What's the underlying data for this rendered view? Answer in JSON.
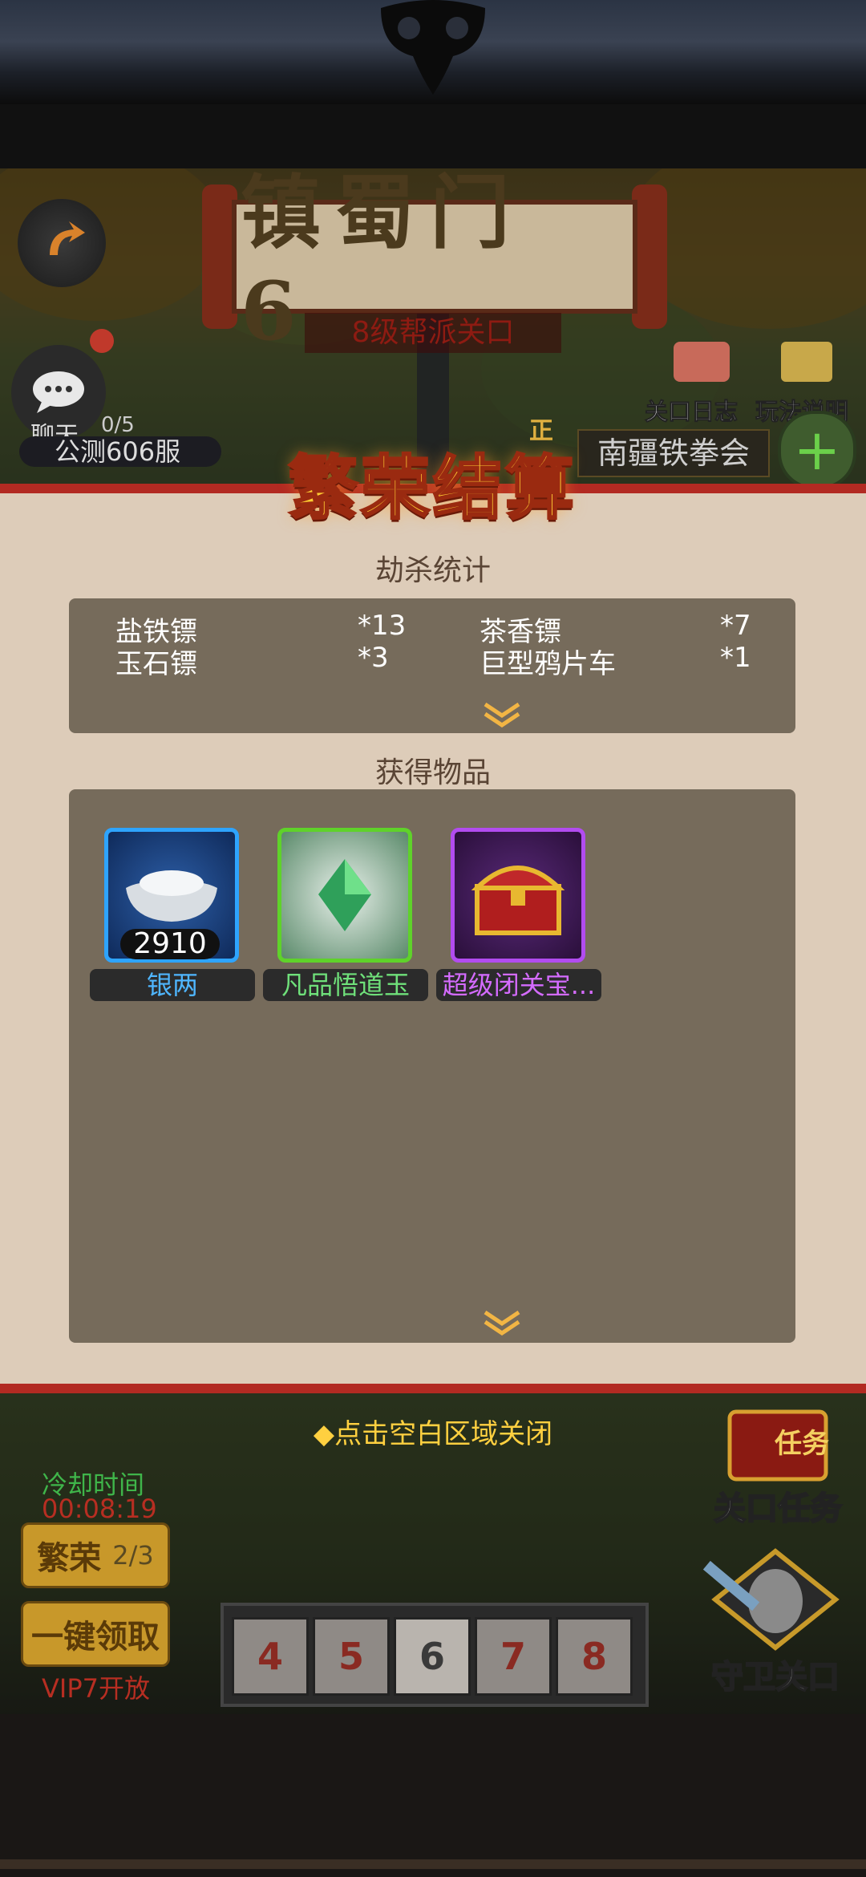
{
  "scene": {
    "stage_title": "镇蜀门 6",
    "stage_subtitle": "8级帮派关口",
    "chat_label": "聊天",
    "chat_count": "0/5",
    "server_name": "公测606服",
    "gate_log_label": "关口日志",
    "how_to_play_label": "玩法说明",
    "guild_name": "南疆铁拳会",
    "badge_zheng": "正"
  },
  "panel": {
    "title": "繁荣结算",
    "kill_stats_title": "劫杀统计",
    "kill_stats": [
      {
        "name": "盐铁镖",
        "count": "*13"
      },
      {
        "name": "茶香镖",
        "count": "*7"
      },
      {
        "name": "玉石镖",
        "count": "*3"
      },
      {
        "name": "巨型鸦片车",
        "count": "*1"
      }
    ],
    "items_title": "获得物品",
    "items": [
      {
        "name": "银两",
        "count": "2910",
        "rarity": "blue",
        "icon": "silver-ingot-icon",
        "name_color": "#4fb6ff"
      },
      {
        "name": "凡品悟道玉",
        "count": "",
        "rarity": "green",
        "icon": "jade-crystal-icon",
        "name_color": "#6fe07a"
      },
      {
        "name": "超级闭关宝...",
        "count": "",
        "rarity": "purple",
        "icon": "treasure-chest-icon",
        "name_color": "#d46bff"
      }
    ]
  },
  "bottom": {
    "close_hint": "◆点击空白区域关闭",
    "cooldown_label": "冷却时间",
    "cooldown_time": "00:08:19",
    "prosperity_label": "繁荣",
    "prosperity_count": "2/3",
    "one_click_claim": "一键领取",
    "vip_unlock": "VIP7开放",
    "gate_task_label": "关口任务",
    "guard_gate_label": "守卫关口",
    "task_badge": "任务",
    "stages": [
      "4",
      "5",
      "6",
      "7",
      "8"
    ],
    "active_stage": "6"
  },
  "colors": {
    "panel_bg": "#ddccb9",
    "panel_border": "#b22a22",
    "box_bg": "#766b5b",
    "hint": "#ffd040"
  }
}
